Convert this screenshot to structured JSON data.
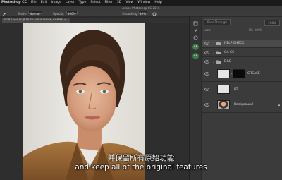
{
  "menubar": {
    "items": [
      "Photoshop CC",
      "File",
      "Edit",
      "Image",
      "Layer",
      "Type",
      "Select",
      "Filter",
      "3D",
      "View",
      "Window",
      "Help"
    ]
  },
  "window_title": "Adobe Photoshop CC 2015",
  "options_bar": {
    "mode_label": "Mode:",
    "mode_value": "Normal",
    "opacity_label": "Opacity:",
    "opacity_value": "100%",
    "smoothing_label": "Smoothing:",
    "smoothing_value": "10%"
  },
  "document_tab": {
    "name": "5878 Sarah.tif @ 16.7% (HELP CHECK, RGB/8*) ×"
  },
  "tool_strip": {
    "badges": [
      "AP",
      "AA"
    ]
  },
  "layers_panel": {
    "blend_mode": "Pass Through",
    "opacity_label": "Opacity:",
    "opacity_value": "100%",
    "lock_label": "Lock:",
    "fill_label": "Fill:",
    "fill_value": "100%",
    "layers": [
      {
        "name": "HELP CHECK",
        "type": "group",
        "visible": true,
        "selected": true
      },
      {
        "name": "GA CC",
        "type": "group",
        "visible": true
      },
      {
        "name": "D&B",
        "type": "group",
        "visible": true
      },
      {
        "name": "CREASE",
        "type": "masked",
        "visible": true
      },
      {
        "name": "RT",
        "type": "pixel",
        "visible": true
      },
      {
        "name": "Background",
        "type": "background",
        "visible": true,
        "locked": true
      }
    ]
  },
  "subtitles": {
    "zh": "并保留所有原始功能",
    "en": "and keep all of the original features"
  },
  "colors": {
    "ui_dark": "#2b2b2b",
    "panel": "#3b3b3b",
    "badge_green": "#3f7a47"
  }
}
